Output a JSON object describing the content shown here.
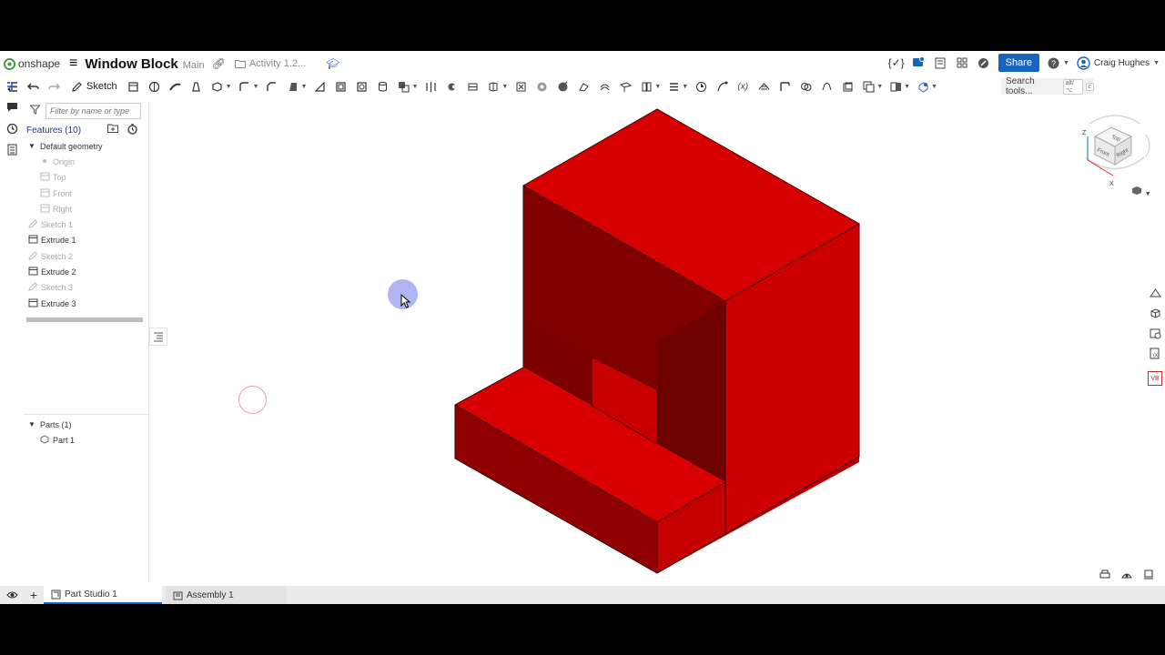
{
  "header": {
    "logo_text": "onshape",
    "doc_title": "Window Block",
    "branch": "Main",
    "folder_label": "Activity 1.2...",
    "share_label": "Share",
    "user_name": "Craig Hughes",
    "accent": "#1565c0"
  },
  "toolbar": {
    "sketch_label": "Sketch",
    "search_label": "Search tools...",
    "shortcut_1": "alt/⌥",
    "shortcut_2": "c"
  },
  "feature_panel": {
    "filter_placeholder": "Filter by name or type",
    "features_header": "Features (10)",
    "default_geometry": "Default geometry",
    "items": [
      {
        "label": "Origin",
        "icon": "origin-icon",
        "dim": true
      },
      {
        "label": "Top",
        "icon": "plane-icon",
        "dim": true
      },
      {
        "label": "Front",
        "icon": "plane-icon",
        "dim": true
      },
      {
        "label": "Right",
        "icon": "plane-icon",
        "dim": true
      },
      {
        "label": "Sketch 1",
        "icon": "sketch-icon",
        "dim": true
      },
      {
        "label": "Extrude 1",
        "icon": "extrude-icon",
        "dim": false
      },
      {
        "label": "Sketch 2",
        "icon": "sketch-icon",
        "dim": true
      },
      {
        "label": "Extrude 2",
        "icon": "extrude-icon",
        "dim": false
      },
      {
        "label": "Sketch 3",
        "icon": "sketch-icon",
        "dim": true
      },
      {
        "label": "Extrude 3",
        "icon": "extrude-icon",
        "dim": false
      }
    ],
    "parts_header": "Parts (1)",
    "parts": [
      "Part 1"
    ]
  },
  "viewcube": {
    "top": "Top",
    "front": "Front",
    "right": "Right",
    "axis_z": "Z",
    "axis_x": "X"
  },
  "tabs": [
    {
      "label": "Part Studio 1",
      "active": true,
      "icon": "part-studio-icon"
    },
    {
      "label": "Assembly 1",
      "active": false,
      "icon": "assembly-icon"
    }
  ],
  "model": {
    "color_top": "#e00000",
    "color_left": "#a80000",
    "color_right": "#cc0000"
  }
}
